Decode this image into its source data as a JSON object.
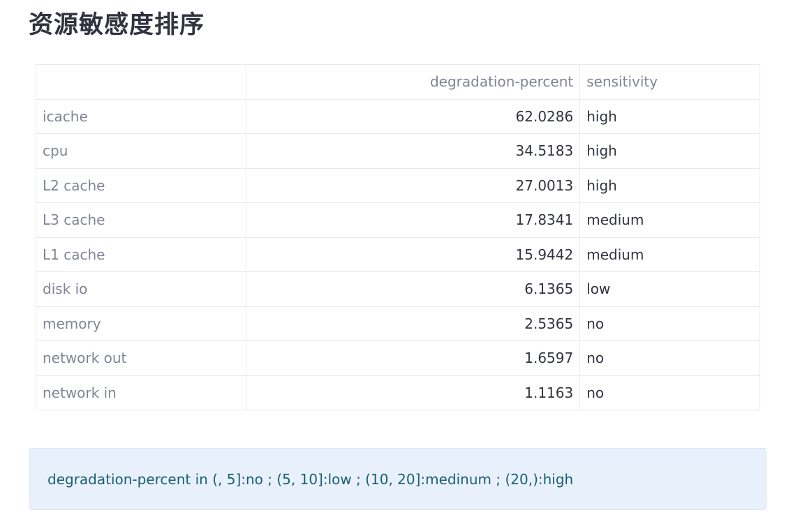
{
  "title": "资源敏感度排序",
  "table": {
    "columns": [
      "",
      "degradation-percent",
      "sensitivity"
    ],
    "rows": [
      {
        "name": "icache",
        "degradation_percent": "62.0286",
        "sensitivity": "high"
      },
      {
        "name": "cpu",
        "degradation_percent": "34.5183",
        "sensitivity": "high"
      },
      {
        "name": "L2 cache",
        "degradation_percent": "27.0013",
        "sensitivity": "high"
      },
      {
        "name": "L3 cache",
        "degradation_percent": "17.8341",
        "sensitivity": "medium"
      },
      {
        "name": "L1 cache",
        "degradation_percent": "15.9442",
        "sensitivity": "medium"
      },
      {
        "name": "disk io",
        "degradation_percent": "6.1365",
        "sensitivity": "low"
      },
      {
        "name": "memory",
        "degradation_percent": "2.5365",
        "sensitivity": "no"
      },
      {
        "name": "network out",
        "degradation_percent": "1.6597",
        "sensitivity": "no"
      },
      {
        "name": "network in",
        "degradation_percent": "1.1163",
        "sensitivity": "no"
      }
    ]
  },
  "info": {
    "text": "degradation-percent in (, 5]:no ; (5, 10]:low ; (10, 20]:medinum ; (20,):high"
  },
  "colors": {
    "info_background": "#e8f1fb",
    "info_text": "#1a5e73",
    "text": "#31333f",
    "muted": "#808495",
    "border": "#e6e9ef"
  }
}
